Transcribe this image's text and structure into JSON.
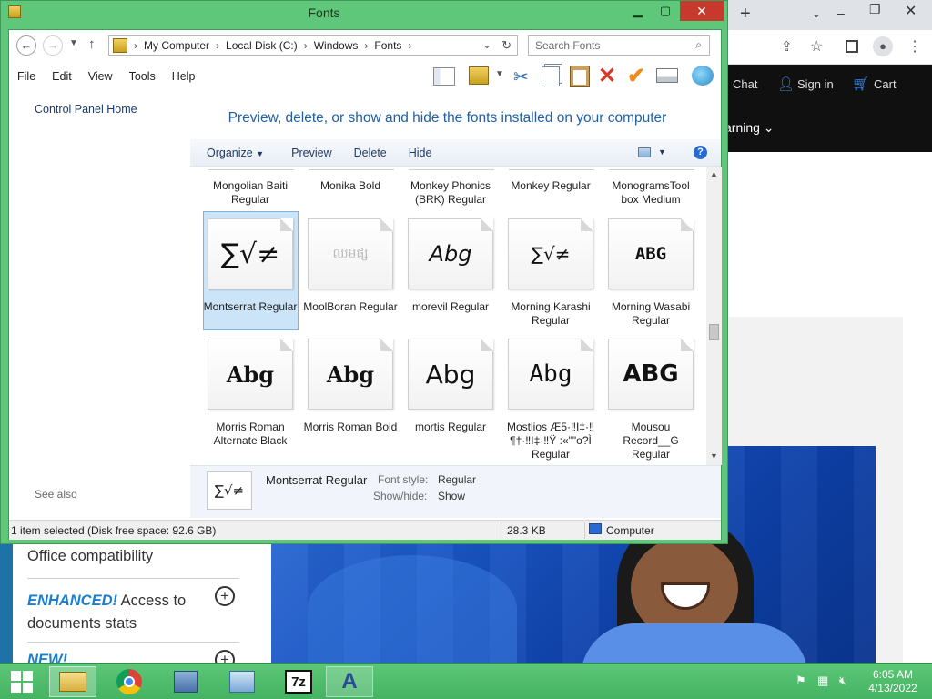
{
  "window": {
    "title": "Fonts",
    "address": {
      "crumbs": [
        "My Computer",
        "Local Disk (C:)",
        "Windows",
        "Fonts"
      ]
    },
    "search_placeholder": "Search Fonts",
    "menu": [
      "File",
      "Edit",
      "View",
      "Tools",
      "Help"
    ],
    "left_pane": {
      "home_link": "Control Panel Home",
      "see_also": "See also"
    },
    "heading": "Preview, delete, or show and hide the fonts installed on your computer",
    "commands": [
      "Organize",
      "Preview",
      "Delete",
      "Hide"
    ],
    "fonts_row0": [
      {
        "name": "Mongolian Baiti Regular"
      },
      {
        "name": "Monika Bold"
      },
      {
        "name": "Monkey Phonics (BRK) Regular"
      },
      {
        "name": "Monkey Regular"
      },
      {
        "name": "MonogramsTool box Medium"
      }
    ],
    "fonts_row1": [
      {
        "name": "Montserrat Regular",
        "preview": "∑√≠",
        "selected": true
      },
      {
        "name": "MoolBoran Regular",
        "preview": "ឈមផ្ស",
        "faded": true
      },
      {
        "name": "morevil Regular",
        "preview": "Abg"
      },
      {
        "name": "Morning Karashi Regular",
        "preview": "∑√≠"
      },
      {
        "name": "Morning Wasabi Regular",
        "preview": "ABG"
      }
    ],
    "fonts_row2": [
      {
        "name": "Morris Roman Alternate Black",
        "preview": "Abg"
      },
      {
        "name": "Morris Roman Bold",
        "preview": "Abg"
      },
      {
        "name": "mortis Regular",
        "preview": "Abg"
      },
      {
        "name": "Mostlios Æ5·‼I‡·‼¶†·‼I‡·‼Ÿ :«\"\"o?Ì Regular",
        "preview": "Abg"
      },
      {
        "name": "Mousou Record__G Regular",
        "preview": "ABG"
      }
    ],
    "details": {
      "preview": "∑√≠",
      "name": "Montserrat Regular",
      "style_label": "Font style:",
      "style_value": "Regular",
      "showhide_label": "Show/hide:",
      "showhide_value": "Show"
    },
    "status": {
      "selection": "1 item selected (Disk free space: 92.6 GB)",
      "size": "28.3 KB",
      "location": "Computer"
    }
  },
  "browser": {
    "nav": {
      "chat": "Chat",
      "signin": "Sign in",
      "cart": "Cart",
      "learning": "arning"
    },
    "sidebar": {
      "office": "Office compatibility",
      "enhanced_tag": "ENHANCED!",
      "enhanced_rest": " Access to",
      "enhanced_line2": "documents stats",
      "new_tag": "NEW!"
    }
  },
  "taskbar": {
    "time": "6:05 AM",
    "date": "4/13/2022"
  },
  "colors": {
    "window_frame": "#5fc77a",
    "close": "#c7392c",
    "heading": "#1e5fa8",
    "selection": "#cce4f7",
    "promo": "#1a55c4"
  }
}
